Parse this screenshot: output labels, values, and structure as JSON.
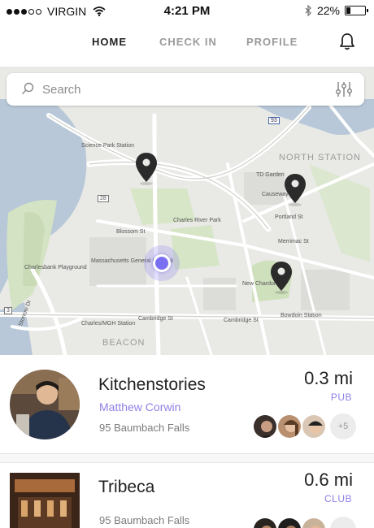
{
  "status_bar": {
    "carrier": "VIRGIN",
    "time": "4:21 PM",
    "battery_percent": "22%",
    "battery_level": 0.22,
    "signal_bars_filled": 3,
    "signal_bars_total": 5
  },
  "nav": {
    "tabs": [
      {
        "label": "HOME",
        "active": true
      },
      {
        "label": "CHECK IN",
        "active": false
      },
      {
        "label": "PROFILE",
        "active": false
      }
    ],
    "bell_icon": "bell-icon"
  },
  "search": {
    "placeholder": "Search",
    "icon": "search-icon",
    "filter_icon": "filter-sliders-icon"
  },
  "map": {
    "labels": {
      "science_park": "Science Park Station",
      "north_station": "NORTH STATION",
      "td_garden": "TD Garden",
      "charles_river_park": "Charles River Park",
      "blossom_st": "Blossom St",
      "mass_general": "Massachusetts General Hospital",
      "charlesbank": "Charlesbank Playground",
      "merrimac_st": "Merrimac St",
      "portland_st": "Portland St",
      "causeway": "Causeway St",
      "new_chardon": "New Chardon St",
      "bowdoin": "Bowdoin Station",
      "charles_mgh": "Charles/MGH Station",
      "cambridge_st_1": "Cambridge St",
      "cambridge_st_2": "Cambridge St",
      "beacon": "BEACON",
      "storrow": "Storrow Dr",
      "route_28": "28",
      "route_3": "3",
      "route_93": "93"
    }
  },
  "venues": [
    {
      "name": "Kitchenstories",
      "user": "Matthew Corwin",
      "address": "95 Baumbach Falls",
      "distance": "0.3 mi",
      "type": "PUB",
      "more_friends": "+5"
    },
    {
      "name": "Tribeca",
      "user": "",
      "address": "95 Baumbach Falls",
      "distance": "0.6 mi",
      "type": "CLUB",
      "more_friends": ""
    }
  ],
  "colors": {
    "accent": "#8e82e8",
    "location_dot": "#7a6ff0",
    "water": "#b8c8d8",
    "park": "#d4e3c3",
    "map_bg": "#e9e9e6"
  }
}
